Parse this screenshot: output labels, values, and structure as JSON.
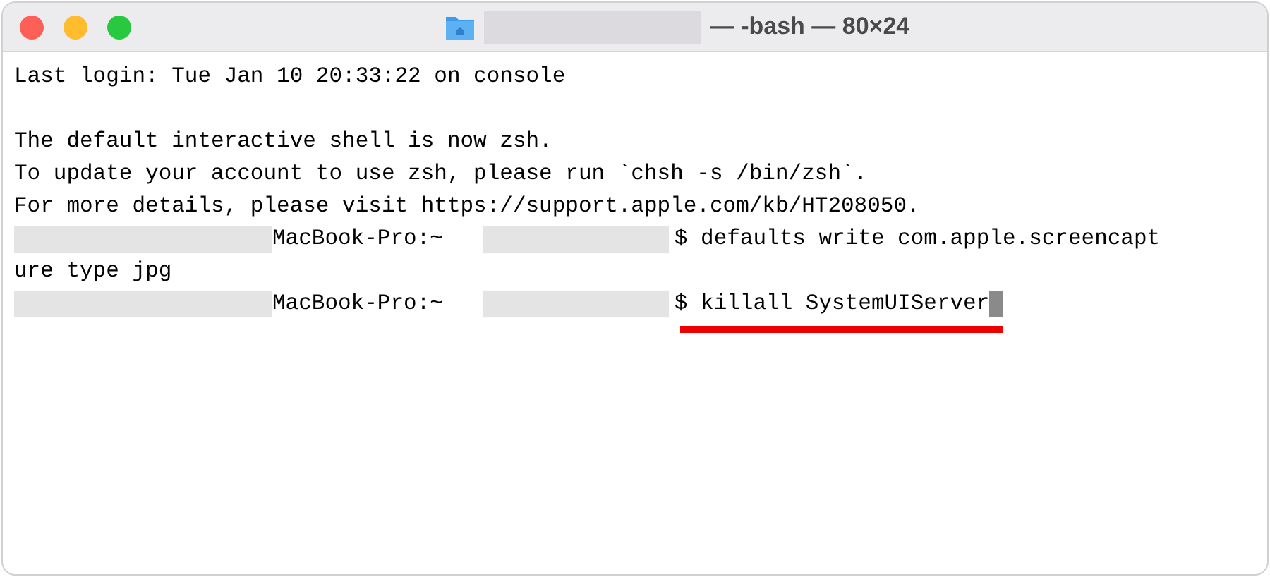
{
  "window": {
    "title": "— -bash — 80×24"
  },
  "lines": [
    {
      "kind": "text",
      "text": "Last login: Tue Jan 10 20:33:22 on console"
    },
    {
      "kind": "blank"
    },
    {
      "kind": "text",
      "text": "The default interactive shell is now zsh."
    },
    {
      "kind": "text",
      "text": "To update your account to use zsh, please run `chsh -s /bin/zsh`."
    },
    {
      "kind": "text",
      "text": "For more details, please visit https://support.apple.com/kb/HT208050."
    },
    {
      "kind": "prompt",
      "host": "MacBook-Pro:~",
      "command": "$ defaults write com.apple.screencapt",
      "cursor": false,
      "highlighted": false
    },
    {
      "kind": "text",
      "text": "ure type jpg"
    },
    {
      "kind": "prompt",
      "host": "MacBook-Pro:~",
      "command": "$ killall SystemUIServer",
      "cursor": true,
      "highlighted": true
    }
  ]
}
